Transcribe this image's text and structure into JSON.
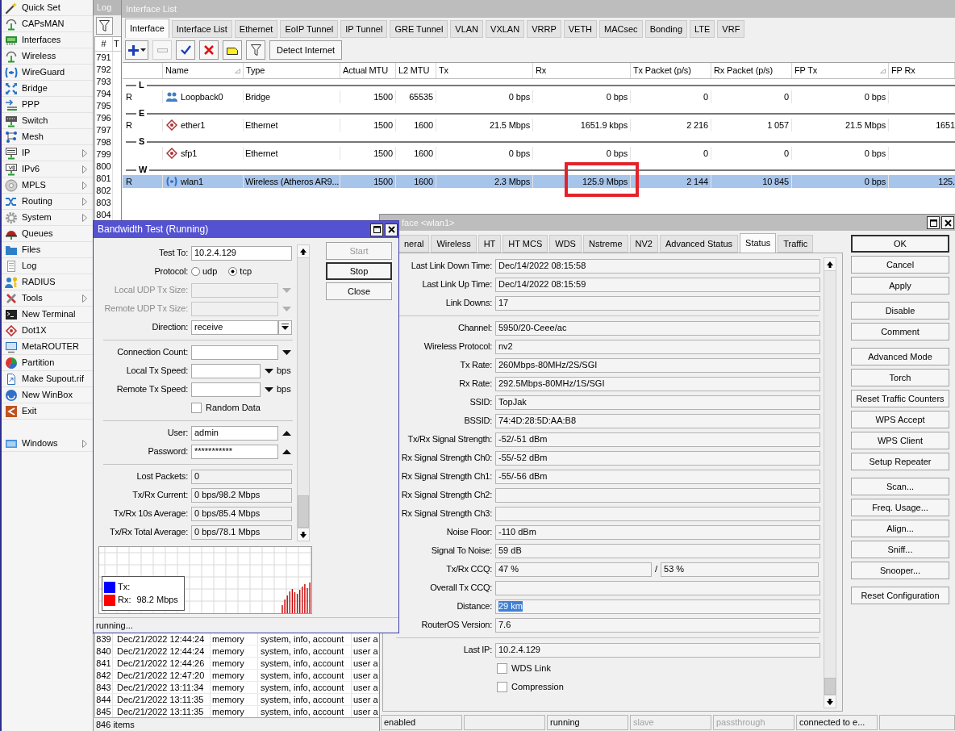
{
  "sidebar": {
    "items": [
      {
        "label": "Quick Set",
        "has_submenu": false
      },
      {
        "label": "CAPsMAN",
        "has_submenu": false
      },
      {
        "label": "Interfaces",
        "has_submenu": false
      },
      {
        "label": "Wireless",
        "has_submenu": false
      },
      {
        "label": "WireGuard",
        "has_submenu": false
      },
      {
        "label": "Bridge",
        "has_submenu": false
      },
      {
        "label": "PPP",
        "has_submenu": false
      },
      {
        "label": "Switch",
        "has_submenu": false
      },
      {
        "label": "Mesh",
        "has_submenu": false
      },
      {
        "label": "IP",
        "has_submenu": true
      },
      {
        "label": "IPv6",
        "has_submenu": true
      },
      {
        "label": "MPLS",
        "has_submenu": true
      },
      {
        "label": "Routing",
        "has_submenu": true
      },
      {
        "label": "System",
        "has_submenu": true
      },
      {
        "label": "Queues",
        "has_submenu": false
      },
      {
        "label": "Files",
        "has_submenu": false
      },
      {
        "label": "Log",
        "has_submenu": false
      },
      {
        "label": "RADIUS",
        "has_submenu": false
      },
      {
        "label": "Tools",
        "has_submenu": true
      },
      {
        "label": "New Terminal",
        "has_submenu": false
      },
      {
        "label": "Dot1X",
        "has_submenu": false
      },
      {
        "label": "MetaROUTER",
        "has_submenu": false
      },
      {
        "label": "Partition",
        "has_submenu": false
      },
      {
        "label": "Make Supout.rif",
        "has_submenu": false
      },
      {
        "label": "New WinBox",
        "has_submenu": false
      },
      {
        "label": "Exit",
        "has_submenu": false
      }
    ],
    "bottom_items": [
      {
        "label": "Windows",
        "has_submenu": true
      }
    ]
  },
  "log_window": {
    "title": "Log",
    "columns": [
      "#",
      "T"
    ],
    "top_rows": [
      {
        "number": "791"
      },
      {
        "number": "792"
      },
      {
        "number": "793"
      },
      {
        "number": "794"
      },
      {
        "number": "795"
      },
      {
        "number": "796"
      },
      {
        "number": "797"
      },
      {
        "number": "798"
      },
      {
        "number": "799"
      },
      {
        "number": "800"
      },
      {
        "number": "801"
      },
      {
        "number": "802"
      },
      {
        "number": "803"
      },
      {
        "number": "804"
      }
    ],
    "bottom_rows": [
      {
        "number": "839",
        "time": "Dec/21/2022 12:44:24",
        "buffer": "memory",
        "topics": "system, info, account",
        "message": "user a"
      },
      {
        "number": "840",
        "time": "Dec/21/2022 12:44:24",
        "buffer": "memory",
        "topics": "system, info, account",
        "message": "user a"
      },
      {
        "number": "841",
        "time": "Dec/21/2022 12:44:26",
        "buffer": "memory",
        "topics": "system, info, account",
        "message": "user a"
      },
      {
        "number": "842",
        "time": "Dec/21/2022 12:47:20",
        "buffer": "memory",
        "topics": "system, info, account",
        "message": "user a"
      },
      {
        "number": "843",
        "time": "Dec/21/2022 13:11:34",
        "buffer": "memory",
        "topics": "system, info, account",
        "message": "user a"
      },
      {
        "number": "844",
        "time": "Dec/21/2022 13:11:35",
        "buffer": "memory",
        "topics": "system, info, account",
        "message": "user a"
      },
      {
        "number": "845",
        "time": "Dec/21/2022 13:11:35",
        "buffer": "memory",
        "topics": "system, info, account",
        "message": "user a"
      }
    ],
    "status": "846 items"
  },
  "interface_list_window": {
    "title": "Interface List",
    "tabs": [
      {
        "label": "Interface",
        "selected": true
      },
      {
        "label": "Interface List",
        "selected": false
      },
      {
        "label": "Ethernet",
        "selected": false
      },
      {
        "label": "EoIP Tunnel",
        "selected": false
      },
      {
        "label": "IP Tunnel",
        "selected": false
      },
      {
        "label": "GRE Tunnel",
        "selected": false
      },
      {
        "label": "VLAN",
        "selected": false
      },
      {
        "label": "VXLAN",
        "selected": false
      },
      {
        "label": "VRRP",
        "selected": false
      },
      {
        "label": "VETH",
        "selected": false
      },
      {
        "label": "MACsec",
        "selected": false
      },
      {
        "label": "Bonding",
        "selected": false
      },
      {
        "label": "LTE",
        "selected": false
      },
      {
        "label": "VRF",
        "selected": false
      }
    ],
    "toolbar": [
      {
        "kind": "add",
        "disabled": false
      },
      {
        "kind": "remove",
        "disabled": true
      },
      {
        "kind": "enable",
        "disabled": false
      },
      {
        "kind": "disable",
        "disabled": false
      },
      {
        "kind": "comment",
        "disabled": false
      },
      {
        "kind": "filter",
        "disabled": false
      },
      {
        "kind": "text",
        "label": "Detect Internet",
        "disabled": false
      }
    ],
    "columns": [
      {
        "label": "Name",
        "sort_mark": true
      },
      {
        "label": "Type",
        "sort_mark": false
      },
      {
        "label": "Actual MTU",
        "sort_mark": false
      },
      {
        "label": "L2 MTU",
        "sort_mark": false
      },
      {
        "label": "Tx",
        "sort_mark": false
      },
      {
        "label": "Rx",
        "sort_mark": false
      },
      {
        "label": "Tx Packet (p/s)",
        "sort_mark": false
      },
      {
        "label": "Rx Packet (p/s)",
        "sort_mark": false
      },
      {
        "label": "FP Tx",
        "sort_mark": true
      },
      {
        "label": "FP Rx",
        "sort_mark": false
      }
    ],
    "groups": [
      {
        "letter": "L",
        "rows": [
          {
            "kind": "bridge",
            "flag": "R",
            "selected": false,
            "rx_outlined": false,
            "cells": [
              "Loopback0",
              "Bridge",
              "1500",
              "65535",
              "0 bps",
              "0 bps",
              "0",
              "0",
              "0 bps"
            ]
          }
        ]
      },
      {
        "letter": "E",
        "rows": [
          {
            "kind": "ethernet",
            "flag": "R",
            "selected": false,
            "rx_outlined": false,
            "cells": [
              "ether1",
              "Ethernet",
              "1500",
              "1600",
              "21.5 Mbps",
              "1651.9 kbps",
              "2 216",
              "1 057",
              "21.5 Mbps",
              "1651"
            ]
          }
        ]
      },
      {
        "letter": "S",
        "rows": [
          {
            "kind": "ethernet",
            "selected": false,
            "rx_outlined": false,
            "cells": [
              "sfp1",
              "Ethernet",
              "1500",
              "1600",
              "0 bps",
              "0 bps",
              "0",
              "0",
              "0 bps"
            ]
          }
        ]
      },
      {
        "letter": "W",
        "rows": [
          {
            "kind": "wireless",
            "flag": "R",
            "selected": true,
            "rx_outlined": true,
            "cells": [
              "wlan1",
              "Wireless (Atheros AR9...",
              "1500",
              "1600",
              "2.3 Mbps",
              "125.9 Mbps",
              "2 144",
              "10 845",
              "0 bps",
              "125."
            ]
          }
        ]
      }
    ]
  },
  "interface_window": {
    "title": "face <wlan1>",
    "tabs": [
      {
        "label": "neral",
        "selected": false
      },
      {
        "label": "Wireless",
        "selected": false
      },
      {
        "label": "HT",
        "selected": false
      },
      {
        "label": "HT MCS",
        "selected": false
      },
      {
        "label": "WDS",
        "selected": false
      },
      {
        "label": "Nstreme",
        "selected": false
      },
      {
        "label": "NV2",
        "selected": false
      },
      {
        "label": "Advanced Status",
        "selected": false
      },
      {
        "label": "Status",
        "selected": true
      },
      {
        "label": "Traffic",
        "selected": false
      }
    ],
    "groups": [
      {
        "fields": [
          {
            "kind": "text",
            "label": "Last Link Down Time:",
            "value": "Dec/14/2022 08:15:58",
            "highlighted": false
          },
          {
            "kind": "text",
            "label": "Last Link Up Time:",
            "value": "Dec/14/2022 08:15:59",
            "highlighted": false
          },
          {
            "kind": "text",
            "label": "Link Downs:",
            "value": "17",
            "highlighted": false
          }
        ]
      },
      {
        "fields": [
          {
            "kind": "text",
            "label": "Channel:",
            "value": "5950/20-Ceee/ac",
            "highlighted": false
          },
          {
            "kind": "text",
            "label": "Wireless Protocol:",
            "value": "nv2",
            "highlighted": false
          },
          {
            "kind": "text",
            "label": "Tx Rate:",
            "value": "260Mbps-80MHz/2S/SGI",
            "highlighted": false
          },
          {
            "kind": "text",
            "label": "Rx Rate:",
            "value": "292.5Mbps-80MHz/1S/SGI",
            "highlighted": false
          },
          {
            "kind": "text",
            "label": "SSID:",
            "value": "TopJak",
            "highlighted": false
          },
          {
            "kind": "text",
            "label": "BSSID:",
            "value": "74:4D:28:5D:AA:B8",
            "highlighted": false
          },
          {
            "kind": "text",
            "label": "Tx/Rx Signal Strength:",
            "value": "-52/-51 dBm",
            "highlighted": false
          },
          {
            "kind": "text",
            "label": "Rx Signal Strength Ch0:",
            "value": "-55/-52 dBm",
            "highlighted": false
          },
          {
            "kind": "text",
            "label": "Rx Signal Strength Ch1:",
            "value": "-55/-56 dBm",
            "highlighted": false
          },
          {
            "kind": "text",
            "label": "Rx Signal Strength Ch2:"
          },
          {
            "kind": "text",
            "label": "Rx Signal Strength Ch3:"
          },
          {
            "kind": "text",
            "label": "Noise Floor:",
            "value": "-110 dBm",
            "highlighted": false
          },
          {
            "kind": "text",
            "label": "Signal To Noise:",
            "value": "59 dB",
            "highlighted": false
          },
          {
            "kind": "pair",
            "label": "Tx/Rx CCQ:",
            "value": "47 %",
            "separator": "/",
            "second_value": "53 %",
            "highlighted": false
          },
          {
            "kind": "text",
            "label": "Overall Tx CCQ:"
          },
          {
            "kind": "text",
            "label": "Distance:",
            "value": "29 km",
            "highlighted": true
          },
          {
            "kind": "text",
            "label": "RouterOS Version:",
            "value": "7.6",
            "highlighted": false
          }
        ]
      },
      {
        "fields": [
          {
            "kind": "text",
            "label": "Last IP:",
            "value": "10.2.4.129",
            "highlighted": false
          },
          {
            "kind": "checkbox",
            "label": "WDS Link",
            "checked": false
          },
          {
            "kind": "checkbox",
            "label": "Compression",
            "checked": false
          }
        ]
      }
    ],
    "button_groups": [
      {
        "buttons": [
          {
            "label": "OK",
            "default": true
          },
          {
            "label": "Cancel",
            "default": false
          },
          {
            "label": "Apply",
            "default": false
          }
        ]
      },
      {
        "buttons": [
          {
            "label": "Disable",
            "default": false
          },
          {
            "label": "Comment",
            "default": false
          }
        ]
      },
      {
        "buttons": [
          {
            "label": "Advanced Mode",
            "default": false
          },
          {
            "label": "Torch",
            "default": false
          },
          {
            "label": "Reset Traffic Counters",
            "default": false
          },
          {
            "label": "WPS Accept",
            "default": false
          },
          {
            "label": "WPS Client",
            "default": false
          },
          {
            "label": "Setup Repeater",
            "default": false
          }
        ]
      },
      {
        "buttons": [
          {
            "label": "Scan...",
            "default": false
          },
          {
            "label": "Freq. Usage...",
            "default": false
          },
          {
            "label": "Align...",
            "default": false
          },
          {
            "label": "Sniff...",
            "default": false
          },
          {
            "label": "Snooper...",
            "default": false
          }
        ]
      },
      {
        "buttons": [
          {
            "label": "Reset Configuration",
            "default": false
          }
        ]
      }
    ],
    "status_bar": [
      {
        "kind": "text",
        "text": "enabled",
        "disabled": false
      },
      {
        "kind": "blank"
      },
      {
        "kind": "text",
        "text": "running",
        "disabled": false
      },
      {
        "kind": "text",
        "text": "slave",
        "disabled": true
      },
      {
        "kind": "text",
        "text": "passthrough",
        "disabled": true
      },
      {
        "kind": "text",
        "text": "connected to e...",
        "disabled": false
      },
      {
        "kind": "blank"
      }
    ]
  },
  "bandwidth_test_window": {
    "title": "Bandwidth Test (Running)",
    "groups": [
      {
        "fields": [
          {
            "kind": "text",
            "label": "Test To:",
            "value": "10.2.4.129",
            "disabled": false
          },
          {
            "kind": "radio",
            "label": "Protocol:",
            "disabled": false,
            "options": [
              {
                "label": "udp",
                "selected": false
              },
              {
                "label": "tcp",
                "selected": true
              }
            ]
          },
          {
            "kind": "combo",
            "label": "Local UDP Tx Size:",
            "disabled": true
          },
          {
            "kind": "combo",
            "label": "Remote UDP Tx Size:",
            "disabled": true
          },
          {
            "kind": "select",
            "label": "Direction:",
            "value": "receive",
            "disabled": false
          }
        ]
      },
      {
        "fields": [
          {
            "kind": "combo",
            "label": "Connection Count:",
            "disabled": false
          },
          {
            "kind": "speed",
            "label": "Local Tx Speed:",
            "unit": "bps",
            "disabled": false
          },
          {
            "kind": "speed",
            "label": "Remote Tx Speed:",
            "unit": "bps",
            "disabled": false
          },
          {
            "kind": "checkbox",
            "label": "Random Data",
            "checked": false,
            "disabled": false
          }
        ]
      },
      {
        "fields": [
          {
            "kind": "collapsible",
            "label": "User:",
            "value": "admin",
            "disabled": false
          },
          {
            "kind": "collapsible",
            "label": "Password:",
            "value": "***********",
            "disabled": false
          }
        ]
      },
      {
        "fields": [
          {
            "kind": "readonly",
            "label": "Lost Packets:",
            "value": "0",
            "disabled": false
          },
          {
            "kind": "readonly",
            "label": "Tx/Rx Current:",
            "value": "0 bps/98.2 Mbps",
            "disabled": false
          },
          {
            "kind": "readonly",
            "label": "Tx/Rx 10s Average:",
            "value": "0 bps/85.4 Mbps",
            "disabled": false
          },
          {
            "kind": "readonly",
            "label": "Tx/Rx Total Average:",
            "value": "0 bps/78.1 Mbps",
            "disabled": false
          }
        ]
      }
    ],
    "buttons": [
      {
        "label": "Start",
        "disabled": true,
        "default": false
      },
      {
        "label": "Stop",
        "disabled": false,
        "default": true
      },
      {
        "label": "Close",
        "disabled": false,
        "default": false
      }
    ],
    "graph": {
      "legend": [
        {
          "label": "Tx:",
          "color": "#0000ff"
        },
        {
          "label": "Rx:",
          "value": "98.2 Mbps",
          "color": "#ff0000"
        }
      ]
    },
    "status": "running..."
  }
}
